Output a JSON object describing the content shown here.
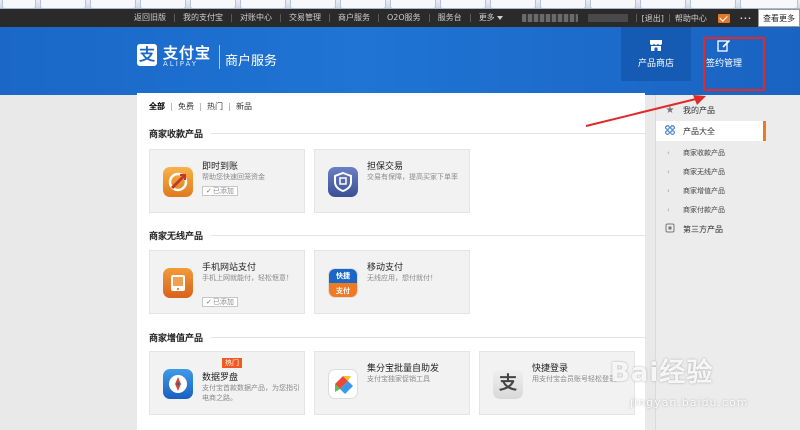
{
  "topbar": {
    "nav": [
      "返回旧版",
      "我的支付宝",
      "对账中心",
      "交易管理",
      "商户服务",
      "O2O服务",
      "服务台",
      "更多"
    ],
    "right": {
      "exit": "[退出]",
      "help": "帮助中心",
      "dots": "···",
      "view_more": "查看更多"
    }
  },
  "header": {
    "logo_char": "支",
    "brand": "支付宝",
    "brand_sub": "ALIPAY",
    "section": "商户服务",
    "nav": [
      {
        "label": "产品商店",
        "icon": "store-icon"
      },
      {
        "label": "签约管理",
        "icon": "edit-icon"
      }
    ]
  },
  "filters": [
    "全部",
    "免费",
    "热门",
    "新品"
  ],
  "sections": [
    {
      "title": "商家收款产品",
      "products": [
        {
          "name": "即时到账",
          "desc": "帮助您快速回笼资金",
          "added": "已添加",
          "icon": "instant-transfer-icon"
        },
        {
          "name": "担保交易",
          "desc": "交易有保障，提高买家下单率",
          "icon": "guarantee-icon"
        }
      ]
    },
    {
      "title": "商家无线产品",
      "products": [
        {
          "name": "手机网站支付",
          "desc": "手机上网就能付，轻松惬意！",
          "added": "已添加",
          "icon": "mobile-web-pay-icon"
        },
        {
          "name": "移动支付",
          "desc": "无线应用，想付就付！",
          "icon": "mobile-pay-icon",
          "icon_text_top": "快捷",
          "icon_text_bottom": "支付"
        }
      ]
    },
    {
      "title": "商家增值产品",
      "products": [
        {
          "name": "数据罗盘",
          "desc": "支付宝首款数据产品，为您指引电商之路。",
          "badge": "热门",
          "icon": "compass-icon"
        },
        {
          "name": "集分宝批量自助发",
          "desc": "支付宝独家促销工具",
          "icon": "points-icon"
        },
        {
          "name": "快捷登录",
          "desc": "用支付宝会员账号轻松登录",
          "icon": "quick-login-icon"
        }
      ]
    }
  ],
  "sidebar": {
    "items": [
      {
        "label": "我的产品",
        "icon": "star-icon"
      },
      {
        "label": "产品大全",
        "icon": "grid-icon"
      }
    ],
    "subitems": [
      "商家收款产品",
      "商家无线产品",
      "商家增值产品",
      "商家付款产品"
    ],
    "third_party": {
      "label": "第三方产品",
      "icon": "plug-icon"
    }
  },
  "watermark": {
    "main": "Bai经验",
    "sub": "jingyan.baidu.com"
  },
  "colors": {
    "header_blue": "#1a67c7",
    "active_orange": "#f07a24",
    "highlight_red": "#e02a2a",
    "topbar": "#2a2a2a"
  }
}
